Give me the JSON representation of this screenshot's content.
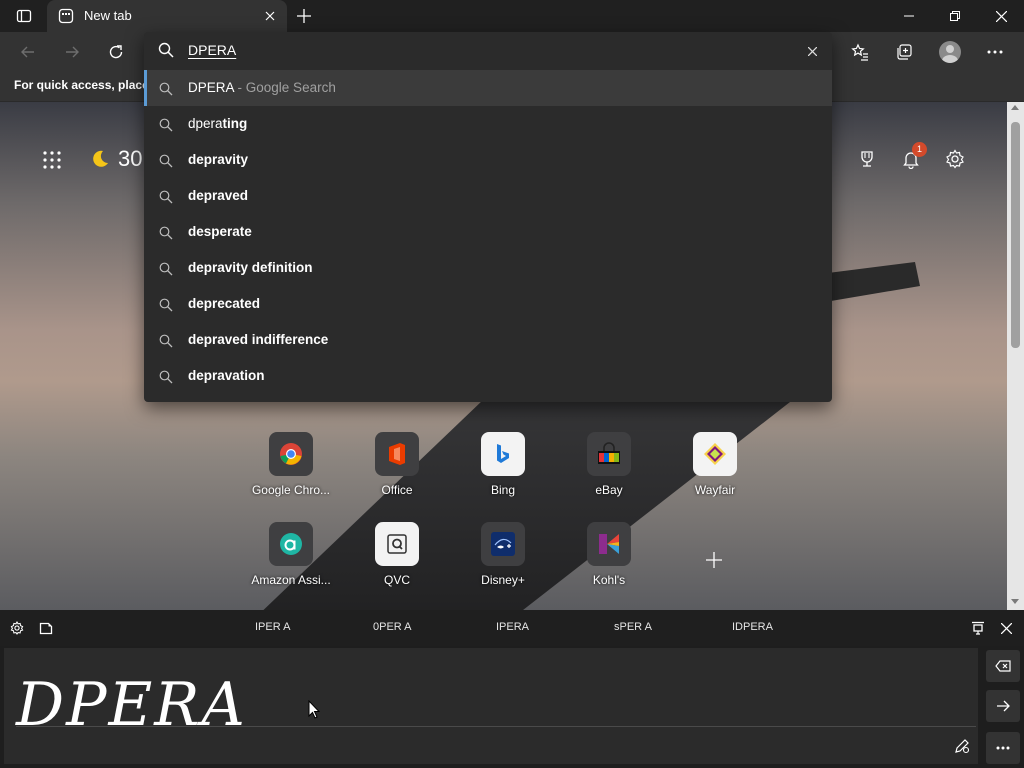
{
  "browser": {
    "tab_title": "New tab",
    "window_controls": [
      "minimize",
      "restore",
      "close"
    ]
  },
  "favorites_bar": {
    "hint": "For quick access, place y"
  },
  "omnibox": {
    "query": "DPERA",
    "suggestions": [
      {
        "prefix": "DPERA",
        "bold": "",
        "suffix": " - Google Search"
      },
      {
        "prefix": "dpera",
        "bold": "ting",
        "suffix": ""
      },
      {
        "prefix": "",
        "bold": "depravity",
        "suffix": ""
      },
      {
        "prefix": "",
        "bold": "depraved",
        "suffix": ""
      },
      {
        "prefix": "",
        "bold": "desperate",
        "suffix": ""
      },
      {
        "prefix": "",
        "bold": "depravity definition",
        "suffix": ""
      },
      {
        "prefix": "",
        "bold": "deprecated",
        "suffix": ""
      },
      {
        "prefix": "",
        "bold": "depraved indifference",
        "suffix": ""
      },
      {
        "prefix": "",
        "bold": "depravation",
        "suffix": ""
      }
    ]
  },
  "page": {
    "weather_temp": "30",
    "notification_count": "1",
    "quick_links": [
      {
        "label": "Google Chro...",
        "icon": "chrome-icon"
      },
      {
        "label": "Office",
        "icon": "office-icon"
      },
      {
        "label": "Bing",
        "icon": "bing-icon"
      },
      {
        "label": "eBay",
        "icon": "ebay-icon"
      },
      {
        "label": "Wayfair",
        "icon": "wayfair-icon"
      },
      {
        "label": "Amazon Assi...",
        "icon": "amazon-assistant-icon"
      },
      {
        "label": "QVC",
        "icon": "qvc-icon"
      },
      {
        "label": "Disney+",
        "icon": "disney-plus-icon"
      },
      {
        "label": "Kohl's",
        "icon": "kohls-icon"
      }
    ]
  },
  "handwriting": {
    "candidates": [
      "IPER A",
      "0PER A",
      "IPERA",
      "sPER A",
      "IDPERA"
    ],
    "ink_text": "DPERA"
  },
  "colors": {
    "accent_blue": "#5b9bd5",
    "badge_red": "#d34a2b",
    "panel_bg": "#2b2b2b"
  }
}
